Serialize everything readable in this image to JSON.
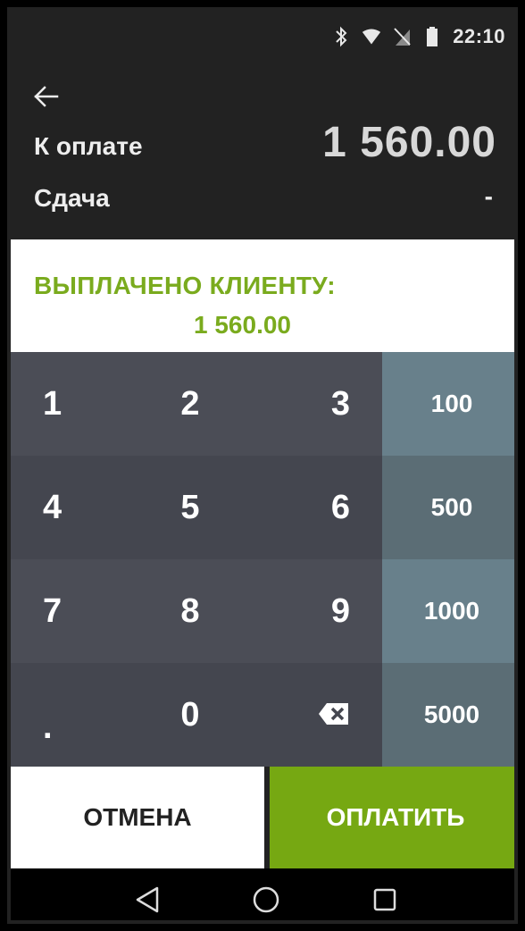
{
  "status_bar": {
    "time": "22:10",
    "icons": [
      "bluetooth-icon",
      "wifi-icon",
      "no-sim-icon",
      "battery-icon"
    ]
  },
  "header": {
    "back_icon": "arrow-left-icon",
    "to_pay_label": "К оплате",
    "to_pay_value": "1 560.00",
    "change_label": "Сдача",
    "change_value": "-"
  },
  "paid_panel": {
    "title": "ВЫПЛАЧЕНО КЛИЕНТУ:",
    "amount": "1 560.00",
    "accent_color": "#7aab1e"
  },
  "keypad": {
    "digits": [
      "1",
      "2",
      "3",
      "4",
      "5",
      "6",
      "7",
      "8",
      "9",
      ".",
      "0"
    ],
    "backspace_icon": "backspace-icon",
    "quick_amounts": [
      "100",
      "500",
      "1000",
      "5000"
    ]
  },
  "actions": {
    "cancel_label": "ОТМЕНА",
    "pay_label": "ОПЛАТИТЬ",
    "pay_color": "#76a812"
  },
  "nav_bar": {
    "icons": [
      "back-triangle-icon",
      "home-circle-icon",
      "recents-square-icon"
    ]
  }
}
